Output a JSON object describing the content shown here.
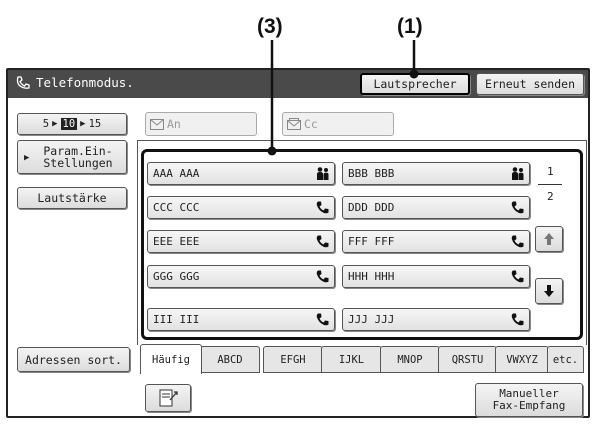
{
  "callouts": {
    "c3": "(3)",
    "c1": "(1)"
  },
  "window": {
    "title": "Telefonmodus."
  },
  "header_buttons": {
    "speaker": "Lautsprecher",
    "resend": "Erneut senden"
  },
  "left_panel": {
    "speed": {
      "a": "5",
      "b": "10",
      "c": "15"
    },
    "settings": [
      "Param.Ein-",
      "Stellungen"
    ],
    "volume": "Lautstärke",
    "sort": "Adressen sort."
  },
  "recipient_fields": {
    "to": "An",
    "cc": "Cc"
  },
  "addresses": [
    {
      "label": "AAA AAA",
      "icon": "group-icon"
    },
    {
      "label": "BBB BBB",
      "icon": "group-icon"
    },
    {
      "label": "CCC CCC",
      "icon": "phone-icon"
    },
    {
      "label": "DDD DDD",
      "icon": "phone-icon"
    },
    {
      "label": "EEE EEE",
      "icon": "phone-icon"
    },
    {
      "label": "FFF FFF",
      "icon": "phone-icon"
    },
    {
      "label": "GGG GGG",
      "icon": "phone-icon"
    },
    {
      "label": "HHH HHH",
      "icon": "phone-icon"
    },
    {
      "label": "III III",
      "icon": "phone-icon"
    },
    {
      "label": "JJJ JJJ",
      "icon": "phone-icon"
    }
  ],
  "pagination": {
    "current": "1",
    "total": "2"
  },
  "tabs": [
    "Häufig",
    "ABCD",
    "EFGH",
    "IJKL",
    "MNOP",
    "QRSTU",
    "VWXYZ",
    "etc."
  ],
  "manual_receive": [
    "Manueller",
    "Fax-Empfang"
  ]
}
